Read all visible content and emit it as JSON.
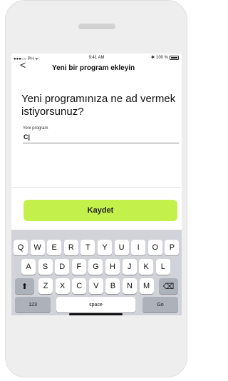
{
  "status_bar": {
    "carrier": "●●●○○ PH",
    "time": "9:41 AM",
    "battery_text": "100 %"
  },
  "header": {
    "back_glyph": "<",
    "title": "Yeni bir program ekleyin"
  },
  "form": {
    "question": "Yeni programınıza ne ad vermek istiyorsunuz?",
    "name_label": "Yeni program",
    "name_value": "C|"
  },
  "save_button": "Kaydet",
  "keyboard": {
    "row1": [
      "Q",
      "W",
      "E",
      "R",
      "T",
      "Y",
      "U",
      "I",
      "O",
      "P"
    ],
    "row2": [
      "A",
      "S",
      "D",
      "F",
      "G",
      "H",
      "J",
      "K",
      "L"
    ],
    "row3": [
      "Z",
      "X",
      "C",
      "V",
      "B",
      "N",
      "M"
    ],
    "shift_glyph": "⬆",
    "delete_glyph": "⌫",
    "numbers_label": "123",
    "space_label": "space",
    "go_label": "Go"
  },
  "colors": {
    "accent": "#c4f04c",
    "keyboard_bg": "#d1d3d9",
    "phone_frame": "#eeeeee"
  }
}
